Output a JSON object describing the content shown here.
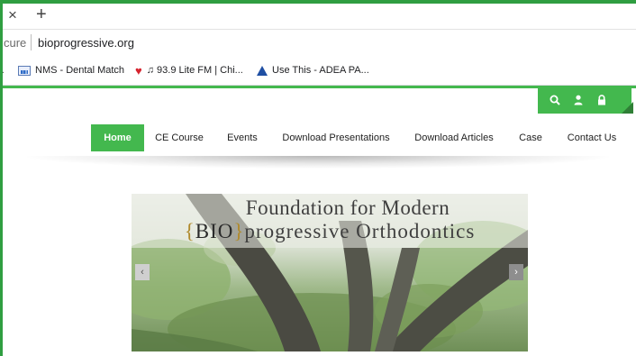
{
  "browser": {
    "tab_close": "×",
    "new_tab": "+",
    "url_prefix": "cure",
    "url": "bioprogressive.org",
    "bookmarks": [
      {
        "label": "NMS - Dental Match",
        "icon": "nms-icon"
      },
      {
        "label": "♫ 93.9 Lite FM | Chi...",
        "icon": "iheart-icon"
      },
      {
        "label": "Use This - ADEA PA...",
        "icon": "adea-icon"
      }
    ]
  },
  "colors": {
    "accent": "#43b84e",
    "frame": "#2f9e41"
  },
  "utility_icons": [
    "search-icon",
    "user-icon",
    "lock-icon"
  ],
  "nav": {
    "items": [
      {
        "label": "Home",
        "active": true
      },
      {
        "label": "CE Course"
      },
      {
        "label": "Events"
      },
      {
        "label": "Download Presentations"
      },
      {
        "label": "Download Articles"
      },
      {
        "label": "Case"
      },
      {
        "label": "Contact Us"
      }
    ]
  },
  "hero": {
    "line1": "Foundation for Modern",
    "brace_open": "{",
    "bio": "BIO",
    "brace_close": "}",
    "line2_rest": "progressive Orthodontics",
    "prev": "‹",
    "next": "›"
  }
}
